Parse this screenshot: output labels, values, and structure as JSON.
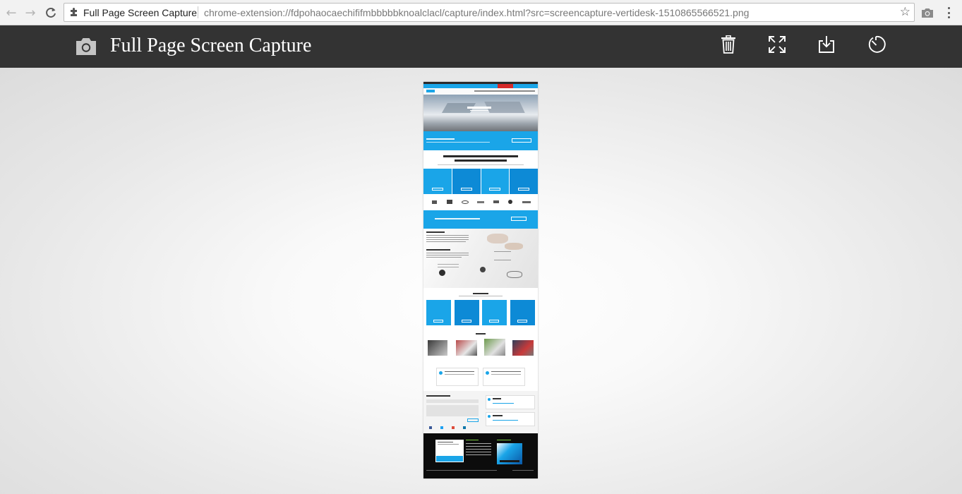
{
  "browser": {
    "tab_title": "Full Page Screen Capture",
    "url": "chrome-extension://fdpohaocaechififmbbbbbknoalclacl/capture/index.html?src=screencapture-vertidesk-1510865566521.png",
    "icons": {
      "back": "back-arrow-icon",
      "forward": "forward-arrow-icon",
      "reload": "reload-icon",
      "extension": "puzzle-icon",
      "bookmark": "star-icon",
      "camera_extension": "camera-icon",
      "menu": "kebab-menu-icon"
    }
  },
  "app": {
    "title": "Full Page Screen Capture",
    "header_color": "#333333",
    "toolbar": [
      {
        "id": "delete",
        "icon": "trash-icon"
      },
      {
        "id": "fullscreen",
        "icon": "expand-icon"
      },
      {
        "id": "download",
        "icon": "download-icon"
      },
      {
        "id": "timer",
        "icon": "timer-icon"
      }
    ]
  },
  "capture": {
    "source": "screencapture-vertidesk-1510865566521.png",
    "accent_color": "#1aa5e8",
    "footer_color": "#0c0c0c"
  }
}
